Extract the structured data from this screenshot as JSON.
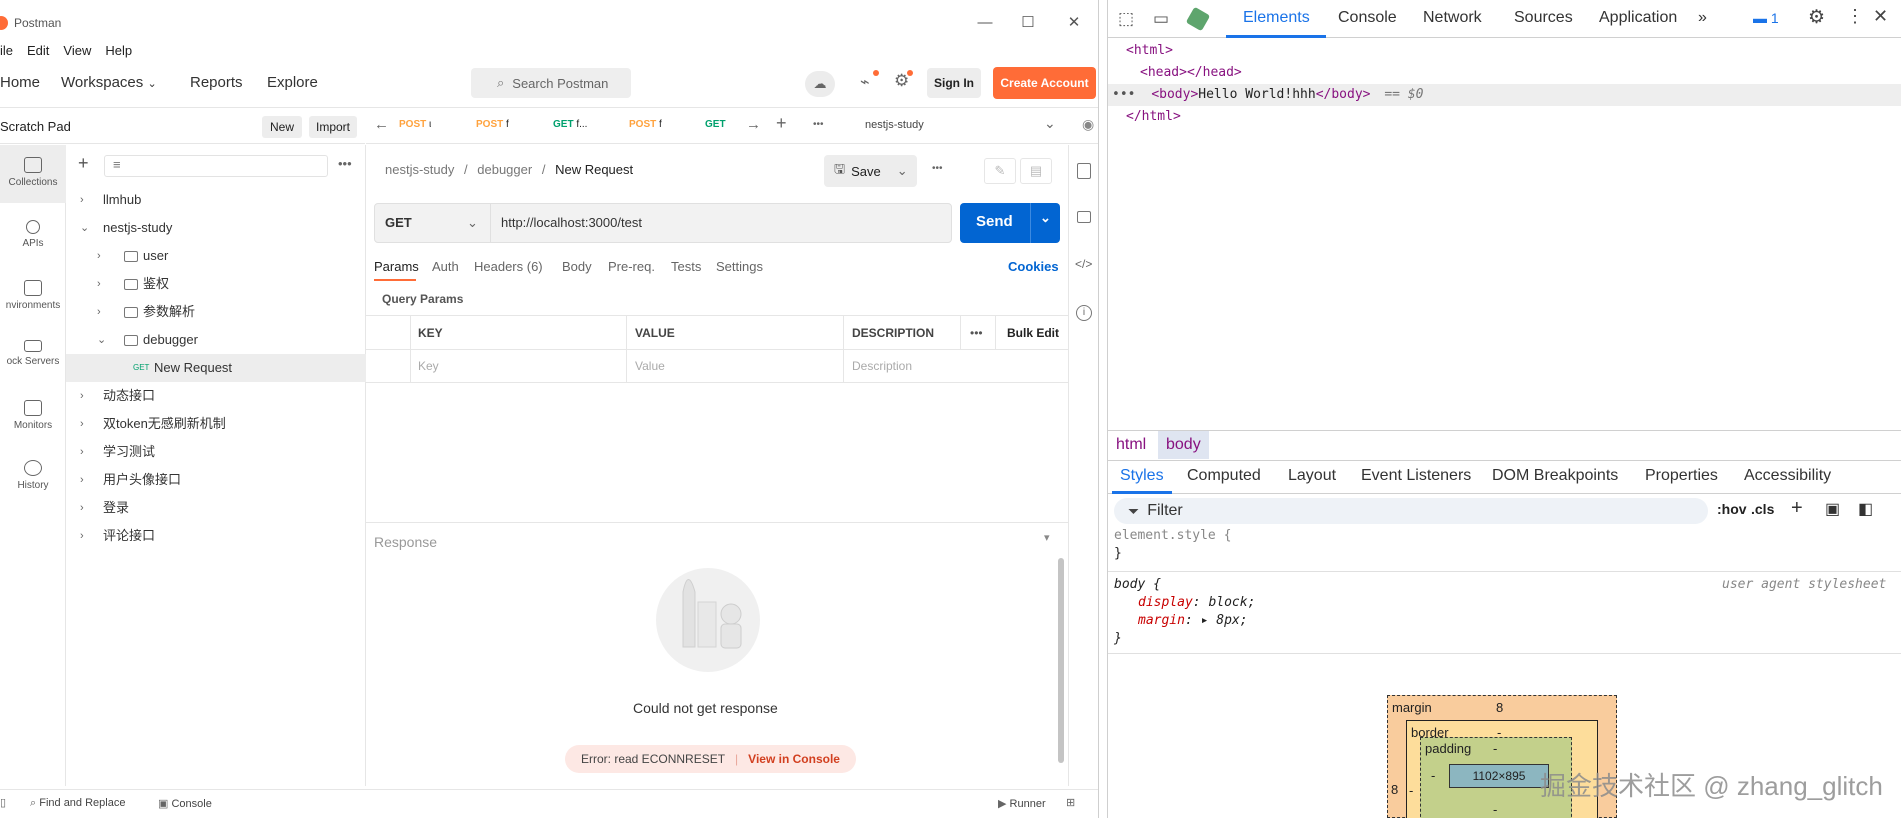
{
  "postman": {
    "window_title": "Postman",
    "menu": [
      "ile",
      "Edit",
      "View",
      "Help"
    ],
    "nav": {
      "home": "Home",
      "workspaces": "Workspaces",
      "reports": "Reports",
      "explore": "Explore"
    },
    "search_placeholder": "Search Postman",
    "sign_in": "Sign In",
    "create_account": "Create Account",
    "scratch_pad": "Scratch Pad",
    "new_btn": "New",
    "import_btn": "Import",
    "rail": [
      "Collections",
      "APIs",
      "nvironments",
      "ock Servers",
      "Monitors",
      "History"
    ],
    "tree": {
      "llmhub": "llmhub",
      "nestjs": "nestjs-study",
      "user": "user",
      "auth": "鉴权",
      "parse": "参数解析",
      "debugger": "debugger",
      "req_method": "GET",
      "req_name": "New Request",
      "dyn": "动态接口",
      "token": "双token无感刷新机制",
      "learn": "学习测试",
      "avatar": "用户头像接口",
      "login": "登录",
      "comment": "评论接口"
    },
    "tabs": [
      {
        "method": "POST",
        "name": "ι"
      },
      {
        "method": "POST",
        "name": "f"
      },
      {
        "method": "GET",
        "name": "f..."
      },
      {
        "method": "POST",
        "name": "f"
      },
      {
        "method": "GET",
        "name": ""
      }
    ],
    "env_select": "nestjs-study",
    "breadcrumb": {
      "a": "nestjs-study",
      "sep": "/",
      "b": "debugger",
      "c": "New Request"
    },
    "save": "Save",
    "method": "GET",
    "url": "http://localhost:3000/test",
    "send": "Send",
    "req_tabs": [
      "Params",
      "Auth",
      "Headers (6)",
      "Body",
      "Pre-req.",
      "Tests",
      "Settings"
    ],
    "cookies": "Cookies",
    "query_params": "Query Params",
    "columns": {
      "key": "KEY",
      "value": "VALUE",
      "desc": "DESCRIPTION",
      "bulk": "Bulk Edit"
    },
    "placeholders": {
      "key": "Key",
      "value": "Value",
      "desc": "Description"
    },
    "response_label": "Response",
    "no_response": "Could not get response",
    "error": "Error: read ECONNRESET",
    "view_console": "View in Console",
    "status": {
      "find": "Find and Replace",
      "console": "Console",
      "runner": "Runner"
    }
  },
  "devtools": {
    "tabs": [
      "Elements",
      "Console",
      "Network",
      "Sources",
      "Application"
    ],
    "issues_count": "1",
    "dom": {
      "html_open": "<html>",
      "head": "<head></head>",
      "body_open": "<body>",
      "body_text": "Hello World!hhh",
      "body_close": "</body>",
      "selected_marker": "== $0",
      "html_close": "</html>"
    },
    "crumbs": [
      "html",
      "body"
    ],
    "subtabs": [
      "Styles",
      "Computed",
      "Layout",
      "Event Listeners",
      "DOM Breakpoints",
      "Properties",
      "Accessibility"
    ],
    "filter_placeholder": "Filter",
    "hov": ":hov",
    "cls": ".cls",
    "styles": {
      "element_style": "element.style {",
      "close": "}",
      "body_sel": "body {",
      "ua": "user agent stylesheet",
      "display_prop": "display",
      "display_val": "block;",
      "margin_prop": "margin",
      "margin_val": "8px;"
    },
    "boxmodel": {
      "margin": "margin",
      "margin_val": "8",
      "border": "border",
      "dash": "-",
      "padding": "padding",
      "content": "1102×895",
      "left_val": "8"
    }
  },
  "watermark": "掘金技术社区 @ zhang_glitch",
  "colors": {
    "postman_orange": "#ff6c37",
    "send_blue": "#0265d2",
    "devtools_accent": "#1a73e8"
  }
}
